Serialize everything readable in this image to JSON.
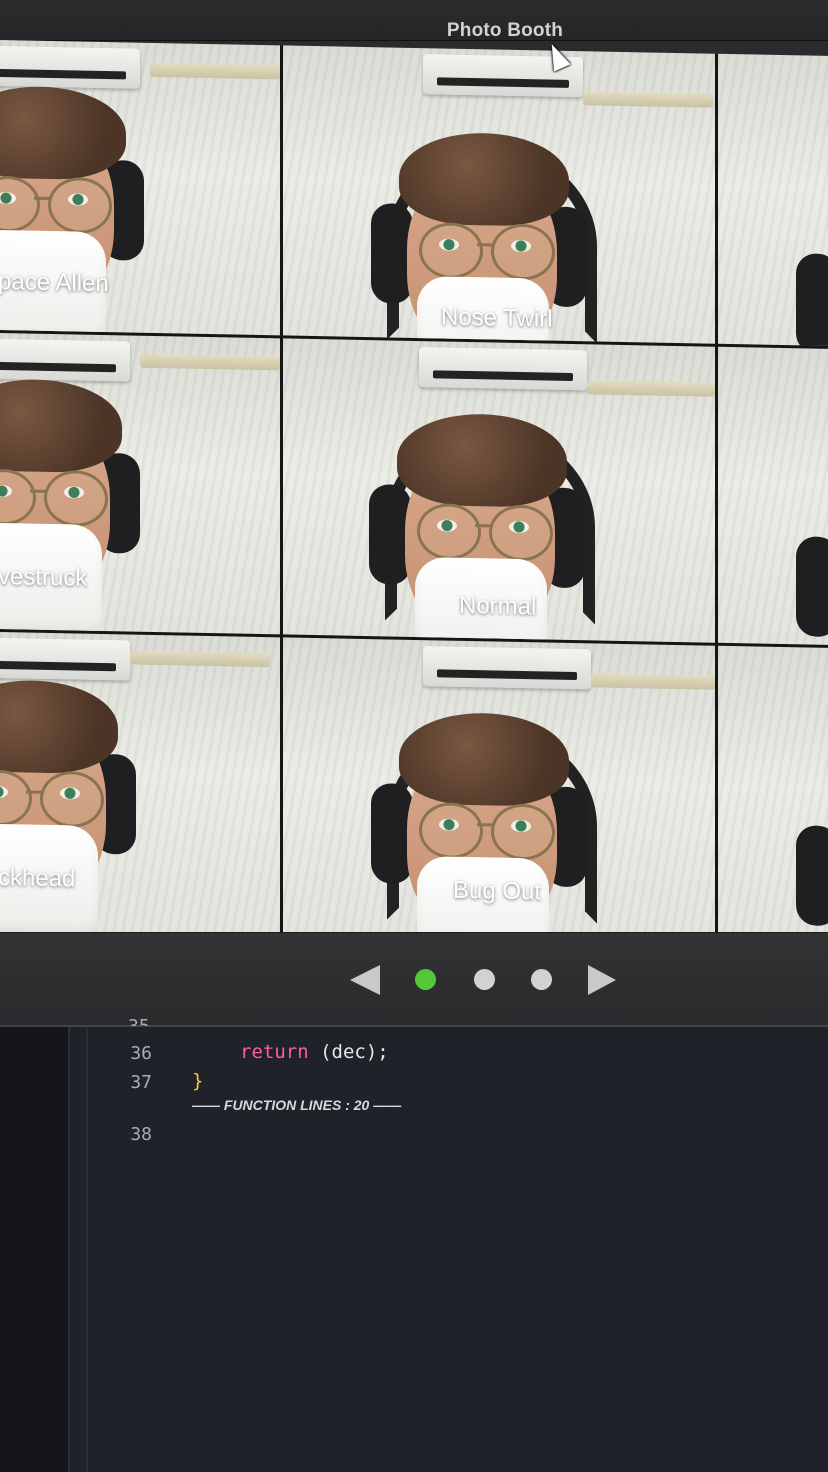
{
  "window": {
    "title": "Photo Booth"
  },
  "effects": [
    {
      "label": "pace Allen"
    },
    {
      "label": "Nose Twirl"
    },
    {
      "label": ""
    },
    {
      "label": "vestruck"
    },
    {
      "label": "Normal"
    },
    {
      "label": ""
    },
    {
      "label": "ckhead"
    },
    {
      "label": "Bug Out"
    },
    {
      "label": ""
    }
  ],
  "pager": {
    "pages": 3,
    "active_page": 1,
    "active_color": "#55c73a"
  },
  "editor": {
    "lines": [
      {
        "number": "36",
        "keyword": "return",
        "rest": " (dec);"
      },
      {
        "number": "37",
        "brace": "}"
      },
      {
        "number": "38"
      }
    ],
    "function_lines_annotation": "—— FUNCTION LINES : 20 ——",
    "partial_line_number": "35"
  }
}
